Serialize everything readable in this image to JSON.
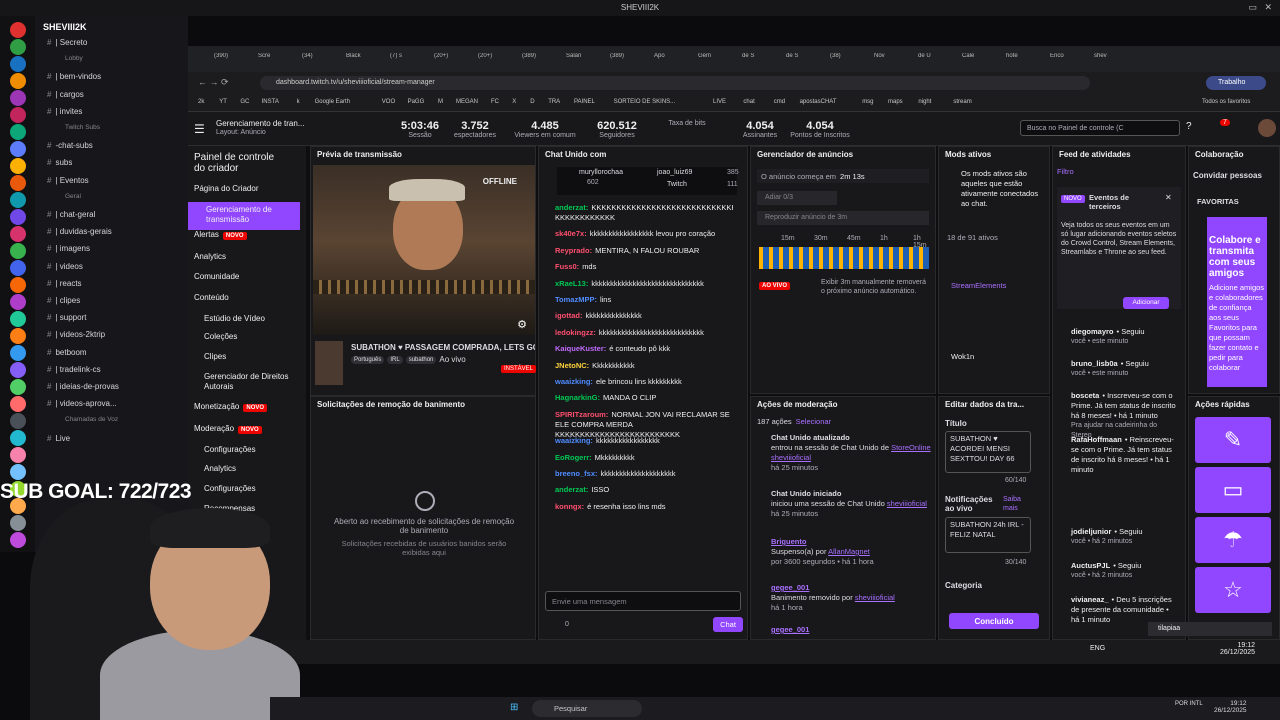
{
  "window_title": "SHEVIII2K",
  "discord": {
    "server_name": "SHEVIII2K",
    "channels": [
      {
        "label": "| Secreto",
        "kind": "dim"
      },
      {
        "label": "Lobby",
        "kind": "cat"
      },
      {
        "label": "| bem-vindos",
        "kind": "ch"
      },
      {
        "label": "| cargos",
        "kind": "ch"
      },
      {
        "label": "| invites",
        "kind": "ch"
      },
      {
        "label": "Twitch Subs",
        "kind": "cat"
      },
      {
        "label": "-chat-subs",
        "kind": "ch"
      },
      {
        "label": "subs",
        "kind": "ch"
      },
      {
        "label": "| Eventos",
        "kind": "ch"
      },
      {
        "label": "Geral",
        "kind": "cat"
      },
      {
        "label": "| chat-geral",
        "kind": "ch"
      },
      {
        "label": "| duvidas-gerais",
        "kind": "ch"
      },
      {
        "label": "| imagens",
        "kind": "ch"
      },
      {
        "label": "| videos",
        "kind": "ch"
      },
      {
        "label": "| reacts",
        "kind": "ch"
      },
      {
        "label": "| clipes",
        "kind": "ch"
      },
      {
        "label": "| support",
        "kind": "ch"
      },
      {
        "label": "| videos-2ktrip",
        "kind": "ch"
      },
      {
        "label": "betboom",
        "kind": "ch"
      },
      {
        "label": "| tradelink-cs",
        "kind": "ch"
      },
      {
        "label": "| ideias-de-provas",
        "kind": "ch"
      },
      {
        "label": "| videos-aprova...",
        "kind": "ch"
      },
      {
        "label": "Chamadas de Voz",
        "kind": "cat"
      },
      {
        "label": "Live",
        "kind": "ch"
      }
    ],
    "new_badge": "NOVO"
  },
  "browser": {
    "url": "dashboard.twitch.tv/u/sheviiioficial/stream-manager",
    "profile": "Trabalho",
    "tabs": [
      "(390)",
      "Scre",
      "(34)",
      "Black",
      "(7) s",
      "(20+)",
      "(20+)",
      "(389)",
      "Salán",
      "(389)",
      "Apo",
      "Gem",
      "de S",
      "de S",
      "(38)",
      "Nov",
      "de U",
      "Cale",
      "hote",
      "Enco",
      "shev"
    ],
    "bookmarks": [
      "2k",
      "YT",
      "GC",
      "INSTA",
      "k",
      "Google Earth",
      "VOO",
      "PaGG",
      "M",
      "MEGAN",
      "FC",
      "X",
      "D",
      "TRA",
      "PAINEL",
      "SORTEIO DE SKINS...",
      "LIVE",
      "chat",
      "cmd",
      "apostasCHAT",
      "msg",
      "maps",
      "night",
      "stream",
      "Todos os favoritos"
    ]
  },
  "twitch": {
    "header": {
      "title": "Gerenciamento de tran...",
      "subtitle": "Layout: Anúncio",
      "search_placeholder": "Busca no Painel de controle (C",
      "stats": [
        {
          "value": "5:03:46",
          "label": "Sessão"
        },
        {
          "value": "3.752",
          "label": "espectadores"
        },
        {
          "value": "4.485",
          "label": "Viewers em comum"
        },
        {
          "value": "620.512",
          "label": "Seguidores"
        },
        {
          "value": "",
          "label": "Taxa de bits"
        },
        {
          "value": "4.054",
          "label": "Assinantes"
        },
        {
          "value": "4.054",
          "label": "Pontos de Inscritos"
        }
      ],
      "notif_count": "7"
    },
    "sidebar": {
      "title": "Painel de controle do criador",
      "items": [
        {
          "label": "Página do Criador",
          "badge": ""
        },
        {
          "label": "Gerenciamento de transmissão",
          "badge": ""
        },
        {
          "label": "Alertas",
          "badge": "NOVO"
        },
        {
          "label": "Analytics",
          "badge": ""
        },
        {
          "label": "Comunidade",
          "badge": ""
        },
        {
          "label": "Conteúdo",
          "badge": ""
        },
        {
          "label": "Estúdio de Vídeo",
          "badge": ""
        },
        {
          "label": "Coleções",
          "badge": ""
        },
        {
          "label": "Clipes",
          "badge": ""
        },
        {
          "label": "Gerenciador de Direitos Autorais",
          "badge": ""
        },
        {
          "label": "Monetização",
          "badge": "NOVO"
        },
        {
          "label": "Moderação",
          "badge": "NOVO"
        },
        {
          "label": "Configurações",
          "badge": ""
        },
        {
          "label": "Analytics",
          "badge": ""
        },
        {
          "label": "Configurações",
          "badge": ""
        },
        {
          "label": "Recompensas",
          "badge": ""
        }
      ]
    },
    "preview": {
      "title": "Prévia de transmissão",
      "offline": "OFFLINE",
      "stream_title": "SUBATHON ♥ PASSAGEM COMPRADA, LETS GO",
      "tags": [
        "Português",
        "IRL",
        "subathon"
      ],
      "ao_vivo": "Ao vivo",
      "instavel": "INSTÁVEL"
    },
    "unban": {
      "title": "Solicitações de remoção de banimento",
      "empty_title": "Aberto ao recebimento de solicitações de remoção de banimento",
      "empty_desc": "Solicitações recebidas de usuários banidos serão exibidas aqui"
    },
    "chat": {
      "title": "Chat Unido com",
      "pinned": [
        {
          "user": "muryllorochaa",
          "count": "602"
        },
        {
          "user": "joao_luiz69",
          "count": "385"
        },
        {
          "user": "Twitch",
          "count": "111"
        }
      ],
      "messages": [
        {
          "user": "anderzat:",
          "color": "#00c853",
          "text": "KKKKKKKKKKKKKKKKKKKKKKKKKKKKKKKKKKKKKKKKKKKK KKKKKKKKKKKK"
        },
        {
          "user": "sk40e7x:",
          "color": "#ff4f6e",
          "text": "kkkkkkkkkkkkkkkkk levou pro coração"
        },
        {
          "user": "Reyprado:",
          "color": "#ff4f6e",
          "text": "MENTIRA, N FALOU ROUBAR"
        },
        {
          "user": "Fuss0:",
          "color": "#ff4f6e",
          "text": "mds"
        },
        {
          "user": "xRaeL13:",
          "color": "#00c853",
          "text": "kkkkkkkkkkkkkkkkkkkkkkkkkkkkkk"
        },
        {
          "user": "TomazMPP:",
          "color": "#4f8cff",
          "text": "lins"
        },
        {
          "user": "igottad:",
          "color": "#ff4f6e",
          "text": "kkkkkkkkkkkkkkk"
        },
        {
          "user": "ledokingzz:",
          "color": "#ff4f6e",
          "text": "kkkkkkkkkkkkkkkkkkkkkkkkkkkk"
        },
        {
          "user": "KaiqueKuster:",
          "color": "#c26bff",
          "text": "é conteudo pô kkk"
        },
        {
          "user": "JNetoNC:",
          "color": "#ffd43b",
          "text": "Kkkkkkkkkkk"
        },
        {
          "user": "waaizking:",
          "color": "#4f8cff",
          "text": "ele brincou lins kkkkkkkkk"
        },
        {
          "user": "HagnarkinG:",
          "color": "#00c853",
          "text": "MANDA O CLIP"
        },
        {
          "user": "SPIRITzaroum:",
          "color": "#ff4f6e",
          "text": "NORMAL JON VAI RECLAMAR SE ELE COMPRA MERDA KKKKKKKKKKKKKKKKKKKKKKKKK"
        },
        {
          "user": "waaizking:",
          "color": "#4f8cff",
          "text": "kkkkkkkkkkkkkkkkk"
        },
        {
          "user": "EoRogerr:",
          "color": "#00c853",
          "text": "Mkkkkkkkkk"
        },
        {
          "user": "breeno_fsx:",
          "color": "#4f8cff",
          "text": "kkkkkkkkkkkkkkkkkkkk"
        },
        {
          "user": "anderzat:",
          "color": "#00c853",
          "text": "ISSO"
        },
        {
          "user": "konngx:",
          "color": "#ff4f6e",
          "text": "é resenha isso lins mds"
        }
      ],
      "input_placeholder": "Envie uma mensagem",
      "points": "0",
      "send_label": "Chat"
    },
    "ads": {
      "title": "Gerenciador de anúncios",
      "next_ad_label": "O anúncio começa em",
      "next_ad_time": "2m 13s",
      "adiar": "Adiar 0/3",
      "reproduzir": "Reproduzir anúncio de 3m",
      "timeline_ticks": [
        "15m",
        "30m",
        "45m",
        "1h",
        "1h 15m"
      ],
      "ao_vivo": "AO VIVO",
      "exibir": "Exibir 3m manualmente removerá o próximo anúncio automático."
    },
    "mods": {
      "title": "Mods ativos",
      "desc": "Os mods ativos são aqueles que estão ativamente conectados ao chat.",
      "count": "18 de 91 ativos",
      "names": [
        "StreamElements",
        "Wok1n"
      ]
    },
    "mod_actions": {
      "title": "Ações de moderação",
      "count": "187 ações",
      "select": "Selecionar",
      "items": [
        {
          "head": "Chat Unido atualizado",
          "user": "StoreOnline",
          "text": "entrou na sessão de Chat Unido de",
          "target": "sheviiioficial",
          "time": "há 25 minutos"
        },
        {
          "head": "Chat Unido iniciado",
          "user": "sheviiioficial",
          "text": "iniciou uma sessão de Chat Unido",
          "target": "",
          "time": "há 25 minutos"
        },
        {
          "head": "Briguento",
          "user": "AllanMagnet",
          "text": "Suspenso(a) por",
          "target": "",
          "time": "por 3600 segundos • há 1 hora"
        },
        {
          "head": "gegee_001",
          "user": "sheviiioficial",
          "text": "Banimento removido por",
          "target": "",
          "time": "há 1 hora"
        },
        {
          "head": "gegee_001",
          "user": "",
          "text": "",
          "target": "",
          "time": ""
        }
      ]
    },
    "editor": {
      "title": "Editar dados da tra...",
      "titulo_label": "Título",
      "titulo_value": "SUBATHON ♥ ACORDEI MENSI SEXTTOU! DAY 66",
      "titulo_count": "60/140",
      "notif_label": "Notificações ao vivo",
      "saiba": "Saiba mais",
      "notif_value": "SUBATHON 24h IRL - FELIZ NATAL",
      "notif_count": "30/140",
      "categoria_label": "Categoria",
      "concluido": "Concluído"
    },
    "feed": {
      "title": "Feed de atividades",
      "filter": "Filtro",
      "promo_badge": "NOVO",
      "promo_title": "Eventos de terceiros",
      "promo_text": "Veja todos os seus eventos em um só lugar adicionando eventos seletos do Crowd Control, Stream Elements, Streamlabs e Throne ao seu feed.",
      "promo_btn": "Adicionar",
      "events": [
        {
          "user": "diegomayro",
          "text": "Seguiu",
          "time": "você • este minuto"
        },
        {
          "user": "bruno_lisb0a",
          "text": "Seguiu",
          "time": "você • este minuto"
        },
        {
          "user": "bosceta",
          "text": "Inscreveu-se com o Prime. Já tem status de inscrito há 8 meses! • há 1 minuto",
          "time": "Pra ajudar na cadeirinha do Stereo"
        },
        {
          "user": "RafaHoffmaan",
          "text": "Reinscreveu-se com o Prime. Já tem status de inscrito há 8 meses! • há 1 minuto",
          "time": ""
        },
        {
          "user": "jodieljunior",
          "text": "Seguiu",
          "time": "você • há 2 minutos"
        },
        {
          "user": "AuctusPJL",
          "text": "Seguiu",
          "time": "você • há 2 minutos"
        },
        {
          "user": "vivianeaz_",
          "text": "Deu 5 inscrições de presente da comunidade • há 1 minuto",
          "time": ""
        }
      ]
    },
    "collab": {
      "title": "Colaboração",
      "invite": "Convidar pessoas",
      "fav_label": "FAVORITAS",
      "promo": "Colabore e transmita com seus amigos",
      "promo_desc": "Adicione amigos e colaboradores de confiança aos seus Favoritos para que possam fazer contato e pedir para colaborar",
      "quick_title": "Ações rápidas"
    }
  },
  "overlay": {
    "subgoal": "SUB GOAL: 722/723",
    "toast": "tilapiaa"
  },
  "system": {
    "search_placeholder": "Pesquisar",
    "lang": "POR INTL",
    "lang2": "ENG",
    "time": "19:12",
    "date": "26/12/2025",
    "time2": "19:12",
    "date2": "26/12/2025"
  }
}
